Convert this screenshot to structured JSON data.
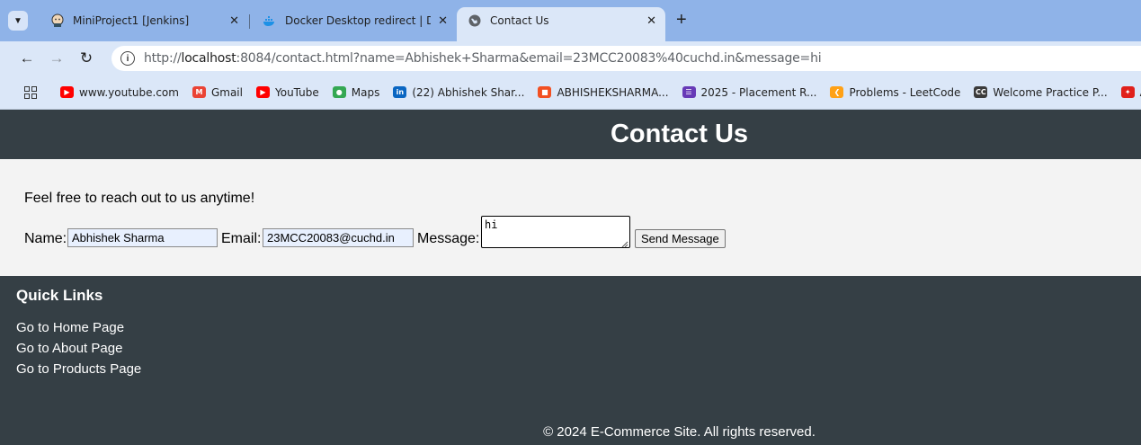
{
  "browser": {
    "tabs": [
      {
        "title": "MiniProject1 [Jenkins]",
        "icon": "jenkins-icon",
        "active": false
      },
      {
        "title": "Docker Desktop redirect | Dock",
        "icon": "docker-icon",
        "active": false
      },
      {
        "title": "Contact Us",
        "icon": "globe-icon",
        "active": true
      }
    ],
    "url_prefix": "http://",
    "url_host": "localhost",
    "url_rest": ":8084/contact.html?name=Abhishek+Sharma&email=23MCC20083%40cuchd.in&message=hi",
    "bookmarks": [
      {
        "label": "www.youtube.com",
        "icon": "youtube-icon",
        "color": "#ff0000"
      },
      {
        "label": "Gmail",
        "icon": "gmail-icon",
        "color": "#ea4335"
      },
      {
        "label": "YouTube",
        "icon": "youtube-icon",
        "color": "#ff0000"
      },
      {
        "label": "Maps",
        "icon": "maps-icon",
        "color": "#34a853"
      },
      {
        "label": "(22) Abhishek Shar...",
        "icon": "linkedin-icon",
        "color": "#0a66c2"
      },
      {
        "label": "ABHISHEKSHARMA...",
        "icon": "microsoft-icon",
        "color": "#f25022"
      },
      {
        "label": "2025 - Placement R...",
        "icon": "forms-icon",
        "color": "#673ab7"
      },
      {
        "label": "Problems - LeetCode",
        "icon": "leetcode-icon",
        "color": "#ffa116"
      },
      {
        "label": "Welcome Practice P...",
        "icon": "cc-icon",
        "color": "#3b3b3b"
      },
      {
        "label": "Adobe Acrobat",
        "icon": "acrobat-icon",
        "color": "#e0201b"
      }
    ]
  },
  "page": {
    "title": "Contact Us",
    "intro": "Feel free to reach out to us anytime!",
    "form": {
      "name_label": "Name:",
      "name_value": "Abhishek Sharma",
      "email_label": "Email:",
      "email_value": "23MCC20083@cuchd.in",
      "message_label": "Message:",
      "message_value": "hi",
      "submit_label": "Send Message"
    },
    "footer": {
      "quick_links_title": "Quick Links",
      "links": [
        "Go to Home Page",
        "Go to About Page",
        "Go to Products Page"
      ],
      "copyright": "© 2024 E-Commerce Site. All rights reserved."
    }
  },
  "colors": {
    "header_bg": "#353f45",
    "content_bg": "#f3f3f3",
    "chrome_tabstrip": "#8fb3e8",
    "chrome_toolbar": "#dbe7f8"
  }
}
